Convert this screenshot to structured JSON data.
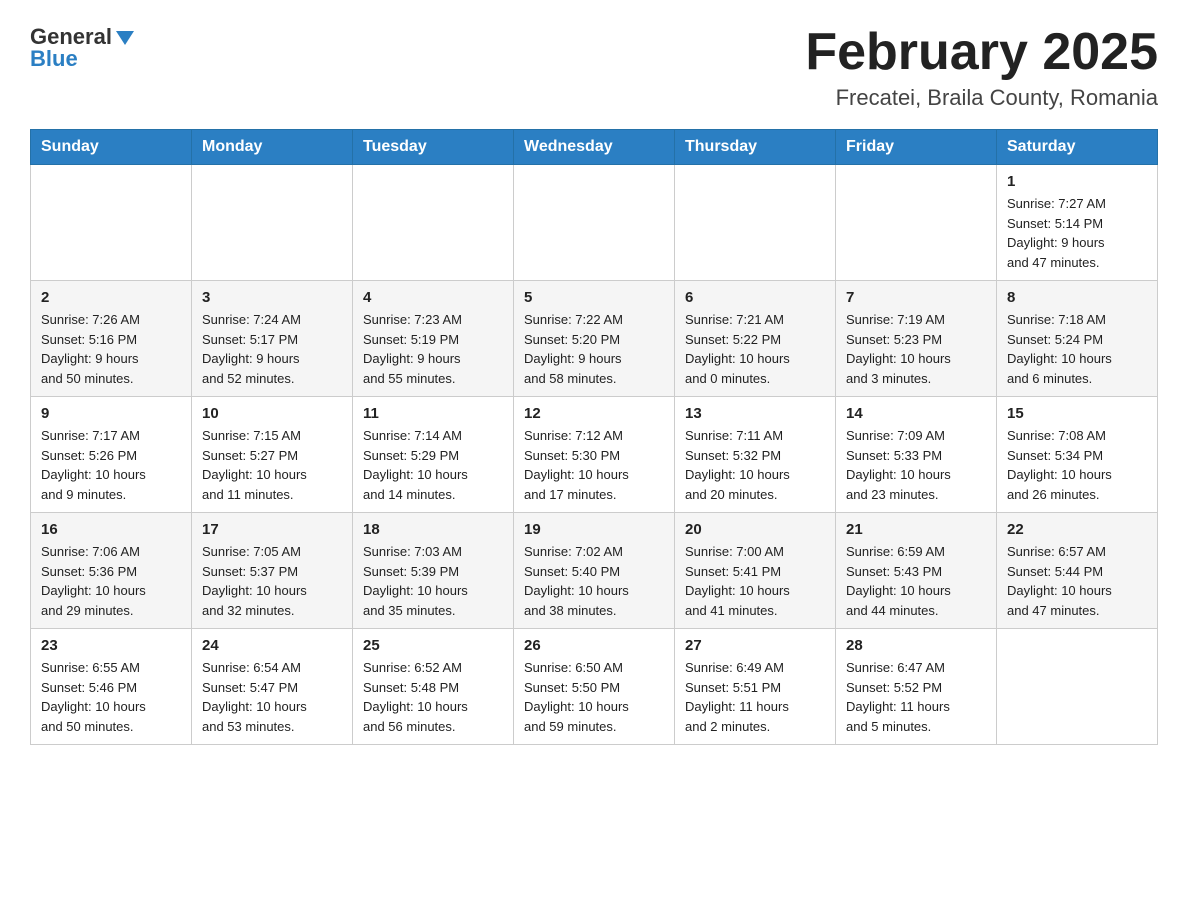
{
  "header": {
    "logo_text": "General",
    "logo_blue": "Blue",
    "title": "February 2025",
    "location": "Frecatei, Braila County, Romania"
  },
  "days_of_week": [
    "Sunday",
    "Monday",
    "Tuesday",
    "Wednesday",
    "Thursday",
    "Friday",
    "Saturday"
  ],
  "weeks": [
    [
      {
        "day": "",
        "info": ""
      },
      {
        "day": "",
        "info": ""
      },
      {
        "day": "",
        "info": ""
      },
      {
        "day": "",
        "info": ""
      },
      {
        "day": "",
        "info": ""
      },
      {
        "day": "",
        "info": ""
      },
      {
        "day": "1",
        "info": "Sunrise: 7:27 AM\nSunset: 5:14 PM\nDaylight: 9 hours\nand 47 minutes."
      }
    ],
    [
      {
        "day": "2",
        "info": "Sunrise: 7:26 AM\nSunset: 5:16 PM\nDaylight: 9 hours\nand 50 minutes."
      },
      {
        "day": "3",
        "info": "Sunrise: 7:24 AM\nSunset: 5:17 PM\nDaylight: 9 hours\nand 52 minutes."
      },
      {
        "day": "4",
        "info": "Sunrise: 7:23 AM\nSunset: 5:19 PM\nDaylight: 9 hours\nand 55 minutes."
      },
      {
        "day": "5",
        "info": "Sunrise: 7:22 AM\nSunset: 5:20 PM\nDaylight: 9 hours\nand 58 minutes."
      },
      {
        "day": "6",
        "info": "Sunrise: 7:21 AM\nSunset: 5:22 PM\nDaylight: 10 hours\nand 0 minutes."
      },
      {
        "day": "7",
        "info": "Sunrise: 7:19 AM\nSunset: 5:23 PM\nDaylight: 10 hours\nand 3 minutes."
      },
      {
        "day": "8",
        "info": "Sunrise: 7:18 AM\nSunset: 5:24 PM\nDaylight: 10 hours\nand 6 minutes."
      }
    ],
    [
      {
        "day": "9",
        "info": "Sunrise: 7:17 AM\nSunset: 5:26 PM\nDaylight: 10 hours\nand 9 minutes."
      },
      {
        "day": "10",
        "info": "Sunrise: 7:15 AM\nSunset: 5:27 PM\nDaylight: 10 hours\nand 11 minutes."
      },
      {
        "day": "11",
        "info": "Sunrise: 7:14 AM\nSunset: 5:29 PM\nDaylight: 10 hours\nand 14 minutes."
      },
      {
        "day": "12",
        "info": "Sunrise: 7:12 AM\nSunset: 5:30 PM\nDaylight: 10 hours\nand 17 minutes."
      },
      {
        "day": "13",
        "info": "Sunrise: 7:11 AM\nSunset: 5:32 PM\nDaylight: 10 hours\nand 20 minutes."
      },
      {
        "day": "14",
        "info": "Sunrise: 7:09 AM\nSunset: 5:33 PM\nDaylight: 10 hours\nand 23 minutes."
      },
      {
        "day": "15",
        "info": "Sunrise: 7:08 AM\nSunset: 5:34 PM\nDaylight: 10 hours\nand 26 minutes."
      }
    ],
    [
      {
        "day": "16",
        "info": "Sunrise: 7:06 AM\nSunset: 5:36 PM\nDaylight: 10 hours\nand 29 minutes."
      },
      {
        "day": "17",
        "info": "Sunrise: 7:05 AM\nSunset: 5:37 PM\nDaylight: 10 hours\nand 32 minutes."
      },
      {
        "day": "18",
        "info": "Sunrise: 7:03 AM\nSunset: 5:39 PM\nDaylight: 10 hours\nand 35 minutes."
      },
      {
        "day": "19",
        "info": "Sunrise: 7:02 AM\nSunset: 5:40 PM\nDaylight: 10 hours\nand 38 minutes."
      },
      {
        "day": "20",
        "info": "Sunrise: 7:00 AM\nSunset: 5:41 PM\nDaylight: 10 hours\nand 41 minutes."
      },
      {
        "day": "21",
        "info": "Sunrise: 6:59 AM\nSunset: 5:43 PM\nDaylight: 10 hours\nand 44 minutes."
      },
      {
        "day": "22",
        "info": "Sunrise: 6:57 AM\nSunset: 5:44 PM\nDaylight: 10 hours\nand 47 minutes."
      }
    ],
    [
      {
        "day": "23",
        "info": "Sunrise: 6:55 AM\nSunset: 5:46 PM\nDaylight: 10 hours\nand 50 minutes."
      },
      {
        "day": "24",
        "info": "Sunrise: 6:54 AM\nSunset: 5:47 PM\nDaylight: 10 hours\nand 53 minutes."
      },
      {
        "day": "25",
        "info": "Sunrise: 6:52 AM\nSunset: 5:48 PM\nDaylight: 10 hours\nand 56 minutes."
      },
      {
        "day": "26",
        "info": "Sunrise: 6:50 AM\nSunset: 5:50 PM\nDaylight: 10 hours\nand 59 minutes."
      },
      {
        "day": "27",
        "info": "Sunrise: 6:49 AM\nSunset: 5:51 PM\nDaylight: 11 hours\nand 2 minutes."
      },
      {
        "day": "28",
        "info": "Sunrise: 6:47 AM\nSunset: 5:52 PM\nDaylight: 11 hours\nand 5 minutes."
      },
      {
        "day": "",
        "info": ""
      }
    ]
  ]
}
